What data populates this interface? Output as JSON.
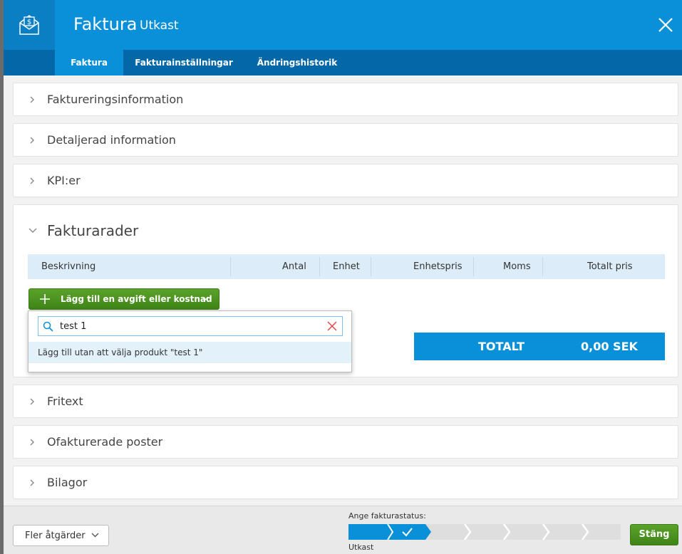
{
  "header": {
    "title": "Faktura",
    "subtitle": "Utkast",
    "accent_color": "#0a90d8",
    "icon": "invoice-envelope-icon"
  },
  "tabs": [
    {
      "label": "Faktura",
      "active": true
    },
    {
      "label": "Fakturainställningar",
      "active": false
    },
    {
      "label": "Ändringshistorik",
      "active": false
    }
  ],
  "sections": {
    "faktureringsinformation": "Faktureringsinformation",
    "detaljerad": "Detaljerad information",
    "kpi": "KPI:er",
    "fritext": "Fritext",
    "ofakturerade": "Ofakturerade poster",
    "bilagor": "Bilagor"
  },
  "fakturarader": {
    "title": "Fakturarader",
    "columns": [
      "Beskrivning",
      "Antal",
      "Enhet",
      "Enhetspris",
      "Moms",
      "Totalt pris"
    ],
    "add_button": "Lägg till en avgift eller kostnad",
    "total_label": "TOTALT",
    "total_value": "0,00 SEK"
  },
  "dropdown": {
    "search_value": "test 1",
    "option": "Lägg till utan att välja produkt \"test 1\""
  },
  "footer": {
    "more_actions": "Fler åtgärder",
    "status_label": "Ange fakturastatus:",
    "status_current": "Utkast",
    "close_button": "Stäng",
    "status_steps_total": 7,
    "status_steps_completed": 1
  }
}
